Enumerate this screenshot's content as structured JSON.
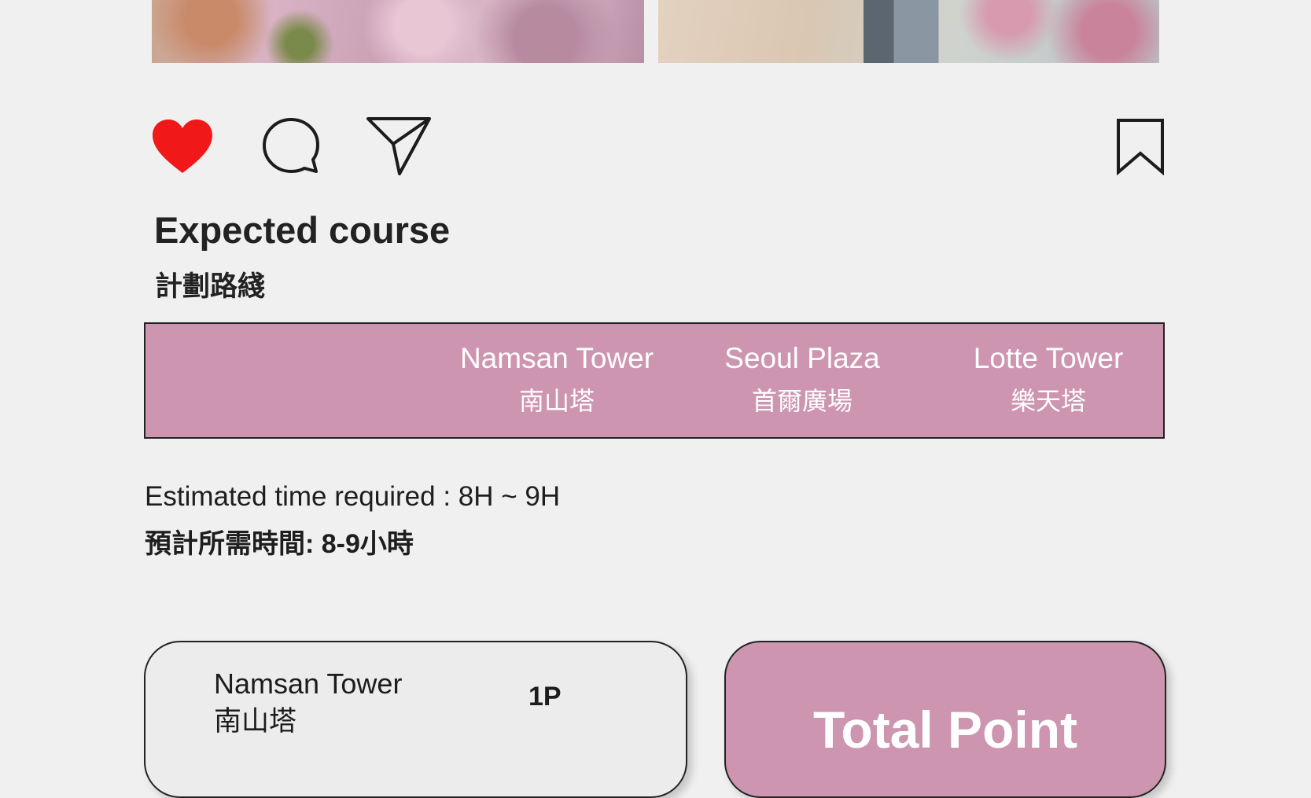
{
  "photos": [
    {
      "name": "cherry-blossom-photo-left"
    },
    {
      "name": "cherry-blossom-photo-right"
    }
  ],
  "actions": {
    "like_color": "#f01818",
    "icons": [
      "heart-icon",
      "comment-icon",
      "share-icon",
      "bookmark-icon"
    ]
  },
  "course": {
    "title_en": "Expected course",
    "title_zh": "計劃路綫"
  },
  "route": {
    "background": "#cd95b0",
    "stops": [
      {
        "en": "Namsan Tower",
        "zh": "南山塔"
      },
      {
        "en": "Seoul Plaza",
        "zh": "首爾廣場"
      },
      {
        "en": "Lotte Tower",
        "zh": "樂天塔"
      }
    ]
  },
  "time": {
    "en": "Estimated time required : 8H ~ 9H",
    "zh": "預計所需時間:  8-9小時"
  },
  "cards": {
    "place": {
      "name_en": "Namsan Tower",
      "name_zh": "南山塔",
      "points": "1P"
    },
    "total_label": "Total Point"
  }
}
